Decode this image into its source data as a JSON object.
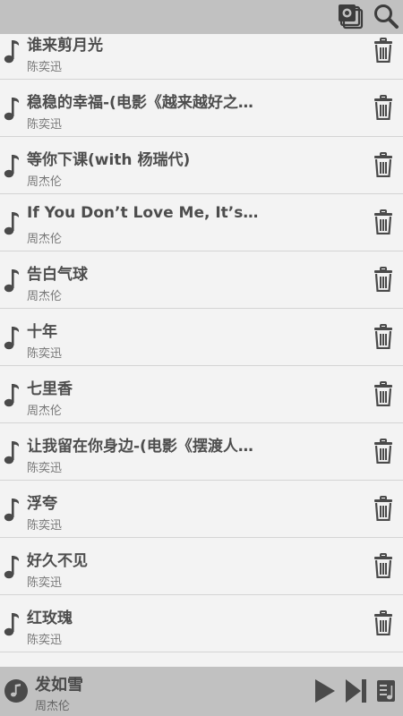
{
  "header": {
    "icons": [
      "playlist-icon",
      "search-icon"
    ]
  },
  "songs": [
    {
      "title": "谁来剪月光",
      "artist": "陈奕迅"
    },
    {
      "title": "稳稳的幸福-(电影《越来越好之…",
      "artist": "陈奕迅"
    },
    {
      "title": "等你下课(with 杨瑞代)",
      "artist": "周杰伦"
    },
    {
      "title": "If You Don’t Love Me, It’s Fine",
      "artist": "周杰伦"
    },
    {
      "title": "告白气球",
      "artist": "周杰伦"
    },
    {
      "title": "十年",
      "artist": "陈奕迅"
    },
    {
      "title": "七里香",
      "artist": "周杰伦"
    },
    {
      "title": "让我留在你身边-(电影《摆渡人…",
      "artist": "陈奕迅"
    },
    {
      "title": "浮夸",
      "artist": "陈奕迅"
    },
    {
      "title": "好久不见",
      "artist": "陈奕迅"
    },
    {
      "title": "红玫瑰",
      "artist": "陈奕迅"
    },
    {
      "title": "",
      "artist": ""
    }
  ],
  "now_playing": {
    "title": "发如雪",
    "artist": "周杰伦"
  },
  "colors": {
    "bar": "#c1c1c1",
    "background": "#f3f3f3",
    "icon": "#4a4a4a"
  }
}
